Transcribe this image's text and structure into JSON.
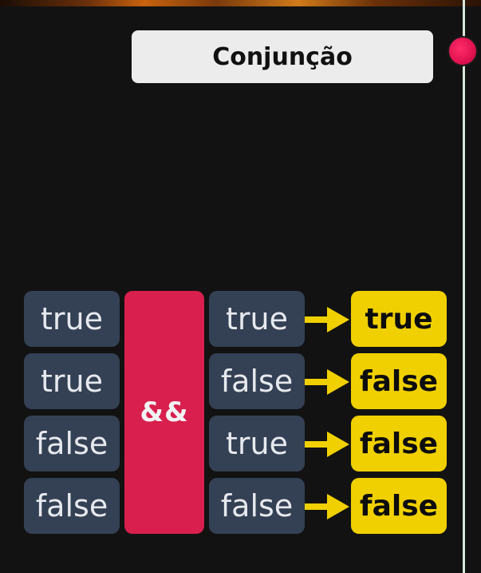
{
  "title": "Conjunção",
  "operator": "&&",
  "rows": [
    {
      "left": "true",
      "right": "true",
      "result": "true"
    },
    {
      "left": "true",
      "right": "false",
      "result": "false"
    },
    {
      "left": "false",
      "right": "true",
      "result": "false"
    },
    {
      "left": "false",
      "right": "false",
      "result": "false"
    }
  ],
  "colors": {
    "operand_bg": "#344054",
    "operator_bg": "#d81f4d",
    "result_bg": "#f0d000",
    "arrow": "#f0d000",
    "timeline_dot": "#e0114f"
  }
}
